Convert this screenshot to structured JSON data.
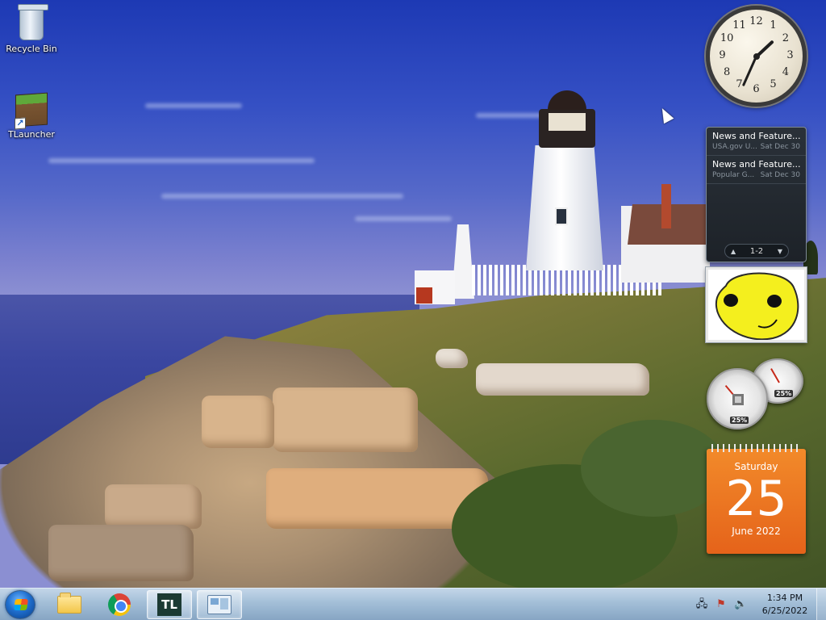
{
  "desktop": {
    "icons": [
      {
        "label": "Recycle Bin",
        "icon": "recycle-bin-icon"
      },
      {
        "label": "TLauncher",
        "icon": "tlauncher-icon"
      }
    ]
  },
  "gadgets": {
    "clock": {
      "hour": 1,
      "minute": 34,
      "numbers": [
        "12",
        "1",
        "2",
        "3",
        "4",
        "5",
        "6",
        "7",
        "8",
        "9",
        "10",
        "11"
      ]
    },
    "feed": {
      "items": [
        {
          "title": "News and Feature...",
          "source": "USA.gov U...",
          "date": "Sat Dec 30"
        },
        {
          "title": "News and Feature...",
          "source": "Popular G...",
          "date": "Sat Dec 30"
        }
      ],
      "pager": "1-2"
    },
    "cpu_meter": {
      "cpu_percent": "25%",
      "memory_percent": "25%"
    },
    "calendar": {
      "weekday": "Saturday",
      "day": "25",
      "month_year": "June 2022"
    }
  },
  "taskbar": {
    "apps": [
      {
        "name": "File Explorer",
        "icon": "folder-icon"
      },
      {
        "name": "Google Chrome",
        "icon": "chrome-icon"
      },
      {
        "name": "TLauncher",
        "icon": "tlauncher-icon",
        "label": "TL",
        "active": true
      },
      {
        "name": "Gadgets",
        "icon": "gadgets-icon"
      }
    ],
    "tray": {
      "time": "1:34 PM",
      "date": "6/25/2022"
    }
  },
  "colors": {
    "calendar_orange": "#e96b1d",
    "feed_bg": "#22282f",
    "taskbar": "#a7c0d8"
  }
}
